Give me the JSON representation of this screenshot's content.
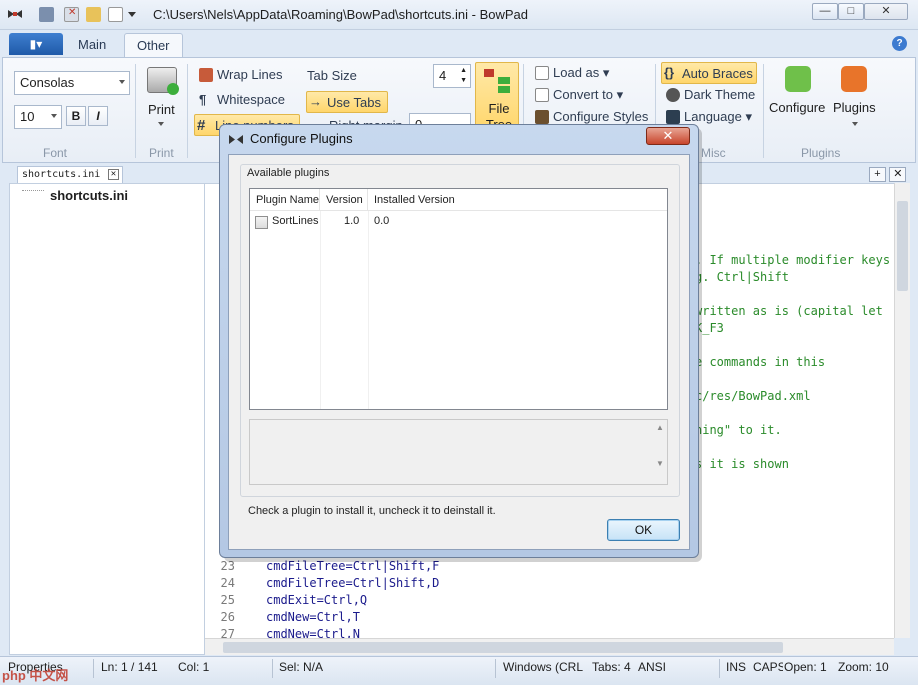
{
  "window": {
    "title": "C:\\Users\\Nels\\AppData\\Roaming\\BowPad\\shortcuts.ini - BowPad",
    "controls": [
      "—",
      "□",
      "✕"
    ]
  },
  "ribbon": {
    "app_menu_label": "▮▾",
    "tabs": [
      "Main",
      "Other"
    ],
    "active_tab": "Other",
    "font": {
      "name": "Consolas",
      "size": "10",
      "bold": "B",
      "italic": "I",
      "label": "Font"
    },
    "print": {
      "label": "Print",
      "group_label": "Print"
    },
    "view": {
      "wrap_lines": "Wrap Lines",
      "whitespace": "Whitespace",
      "line_numbers": "Line numbers",
      "tab_size": "Tab Size",
      "tab_size_value": "4",
      "use_tabs": "Use Tabs",
      "file_tree": "File Tree",
      "right_margin": "Right margin",
      "right_margin_value": "0"
    },
    "tools": {
      "load_as": "Load as",
      "convert_to": "Convert to",
      "configure_styles": "Configure Styles"
    },
    "misc": {
      "auto_braces": "Auto Braces",
      "dark_theme": "Dark Theme",
      "language": "Language",
      "label": "Misc"
    },
    "plugins": {
      "configure": "Configure",
      "plugins": "Plugins",
      "group_label": "Plugins"
    }
  },
  "document": {
    "tab_name": "shortcuts.ini",
    "tree_item": "shortcuts.ini",
    "visible_fragments": [
      {
        "text": ". If multiple modifier keys",
        "cls": "comment"
      },
      {
        "text": "g. Ctrl|Shift",
        "cls": "comment"
      },
      {
        "text": "written as is (capital let",
        "cls": "comment"
      },
      {
        "text": "K_F3",
        "cls": "comment"
      },
      {
        "text": "e commands in this",
        "cls": "comment"
      },
      {
        "text": "c/res/BowPad.xml",
        "cls": "comment"
      },
      {
        "text": "hing\" to it.",
        "cls": "comment"
      },
      {
        "text": "s it is shown",
        "cls": "comment"
      }
    ],
    "lines": [
      {
        "num": "23",
        "text": "cmdFileTree=Ctrl|Shift,F"
      },
      {
        "num": "24",
        "text": "cmdFileTree=Ctrl|Shift,D"
      },
      {
        "num": "25",
        "text": "cmdExit=Ctrl,Q"
      },
      {
        "num": "26",
        "text": "cmdNew=Ctrl,T"
      },
      {
        "num": "27",
        "text": "cmdNew=Ctrl,N"
      }
    ]
  },
  "status": {
    "properties": "Properties",
    "ln": "Ln: 1 / 141",
    "col": "Col: 1",
    "sel": "Sel: N/A",
    "eol": "Windows (CRL",
    "tabs": "Tabs: 4",
    "encoding": "ANSI",
    "ins": "INS",
    "caps": "CAPS",
    "open": "Open: 1",
    "zoom": "Zoom: 10"
  },
  "dialog": {
    "title": "Configure Plugins",
    "close": "✕",
    "group_title": "Available plugins",
    "columns": [
      "Plugin Name",
      "Version",
      "Installed Version"
    ],
    "plugins": [
      {
        "name": "SortLines",
        "version": "1.0",
        "installed": "0.0",
        "checked": false
      }
    ],
    "hint": "Check a plugin to install it, uncheck it to deinstall it.",
    "ok": "OK"
  },
  "watermark": "php 中文网"
}
